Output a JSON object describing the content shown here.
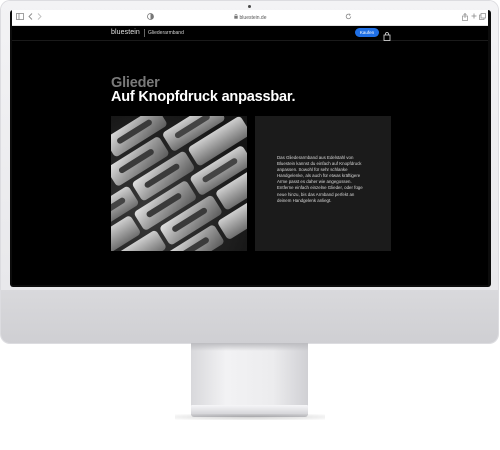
{
  "browser": {
    "url": "bluestein.de",
    "icons": [
      "sidebar-icon",
      "back-icon",
      "forward-icon",
      "privacy-icon",
      "reload-icon",
      "share-icon",
      "new-tab-icon",
      "tabs-icon"
    ]
  },
  "site": {
    "logo": "bluestein",
    "product": "Gliederarmband",
    "buy_label": "Kaufen",
    "eyebrow": "Glieder",
    "headline": "Auf Knopfdruck anpassbar.",
    "description": "Das Gliederarmband aus Edelstahl von Bluestein kannst du einfach auf Knopfdruck anpassen. Sowohl für sehr schlanke Handgelenke, als auch für etwas kräftigere Arme passt es daher wie angegossen. Entferne einfach einzelne Glieder, oder füge neue hinzu, bis das Armband perfekt an deinem Handgelenk anliegt."
  },
  "colors": {
    "accent": "#1f6fe5",
    "page_background": "#000000",
    "panel_background": "#1b1b1b",
    "eyebrow": "#7a7a7a"
  }
}
